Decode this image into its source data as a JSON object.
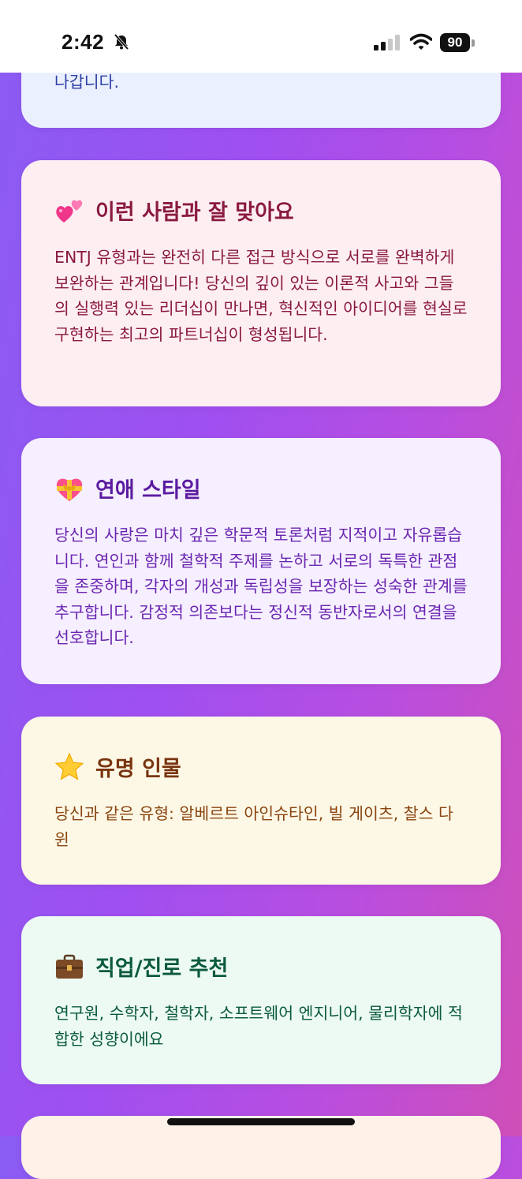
{
  "status_bar": {
    "time": "2:42",
    "battery": "90"
  },
  "cards": {
    "top": {
      "body": "나갑니다."
    },
    "match": {
      "icon": "two-hearts-icon",
      "title": "이런 사람과 잘 맞아요",
      "body": "ENTJ 유형과는 완전히 다른 접근 방식으로 서로를 완벽하게 보완하는 관계입니다! 당신의 깊이 있는 이론적 사고와 그들의 실행력 있는 리더십이 만나면, 혁신적인 아이디어를 현실로 구현하는 최고의 파트너십이 형성됩니다."
    },
    "love": {
      "icon": "heart-with-ribbon-icon",
      "title": "연애 스타일",
      "body": "당신의 사랑은 마치 깊은 학문적 토론처럼 지적이고 자유롭습니다. 연인과 함께 철학적 주제를 논하고 서로의 독특한 관점을 존중하며, 각자의 개성과 독립성을 보장하는 성숙한 관계를 추구합니다. 감정적 의존보다는 정신적 동반자로서의 연결을 선호합니다."
    },
    "famous": {
      "icon": "star-icon",
      "title": "유명 인물",
      "body": "당신과 같은 유형: 알베르트 아인슈타인, 빌 게이츠, 찰스 다윈"
    },
    "career": {
      "icon": "briefcase-icon",
      "title": "직업/진로 추천",
      "body": "연구원, 수학자, 철학자, 소프트웨어 엔지니어, 물리학자에 적합한 성향이에요"
    }
  }
}
